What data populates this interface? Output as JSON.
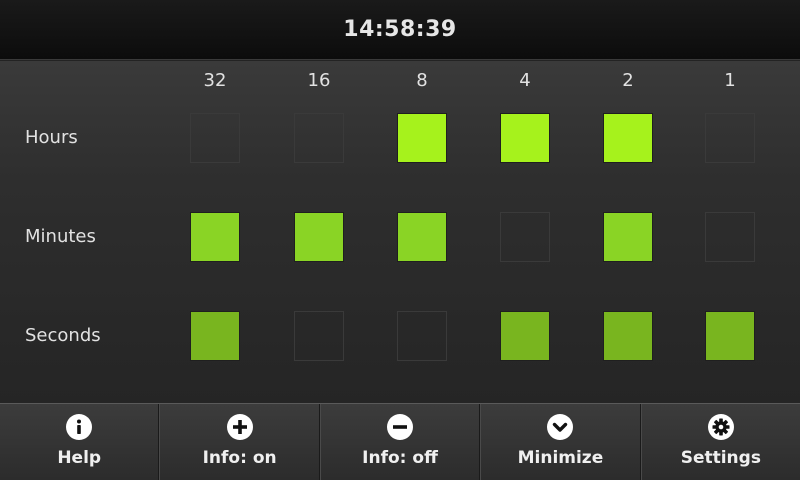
{
  "clock": {
    "time": "14:58:39"
  },
  "columns": [
    "32",
    "16",
    "8",
    "4",
    "2",
    "1"
  ],
  "rows": [
    {
      "label": "Hours",
      "bits": [
        0,
        0,
        1,
        1,
        1,
        0
      ],
      "color": "#a6f21c"
    },
    {
      "label": "Minutes",
      "bits": [
        1,
        1,
        1,
        0,
        1,
        0
      ],
      "color": "#8ad425"
    },
    {
      "label": "Seconds",
      "bits": [
        1,
        0,
        0,
        1,
        1,
        1
      ],
      "color": "#79b51f"
    }
  ],
  "toolbar": [
    {
      "label": "Help",
      "icon": "info-icon"
    },
    {
      "label": "Info: on",
      "icon": "plus-icon"
    },
    {
      "label": "Info: off",
      "icon": "minus-icon"
    },
    {
      "label": "Minimize",
      "icon": "chevron-down-icon"
    },
    {
      "label": "Settings",
      "icon": "gear-icon"
    }
  ]
}
